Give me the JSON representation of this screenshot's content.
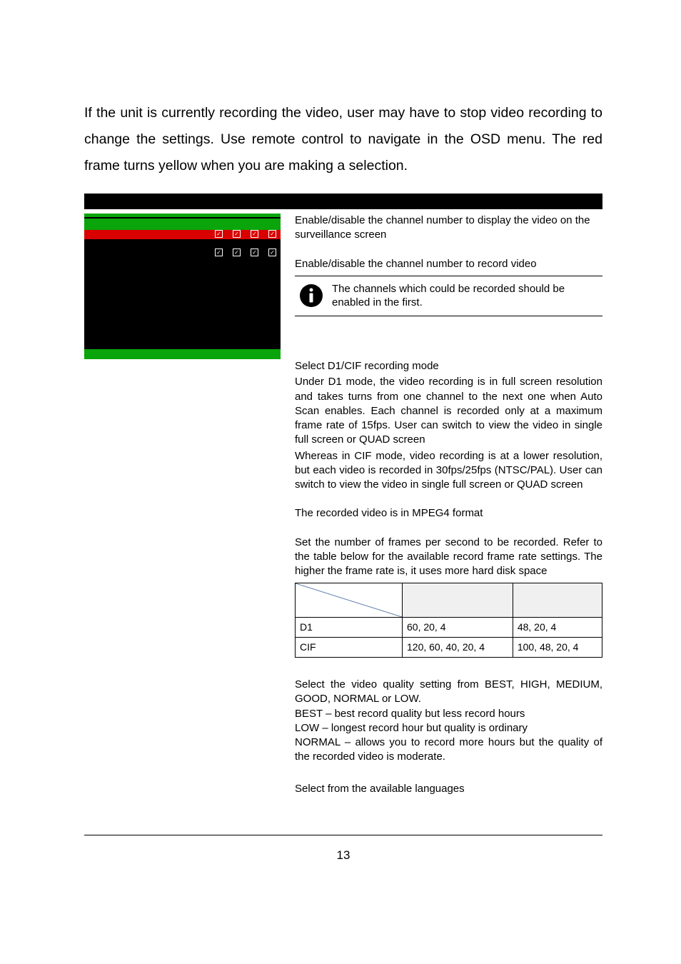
{
  "intro": "If the unit is currently recording the video, user may have to stop video recording to change the settings. Use remote control to navigate in the OSD menu. The red frame turns yellow when you are making a selection.",
  "camera_select": {
    "text": "Enable/disable the channel number to display the video on the surveillance screen"
  },
  "record_select": {
    "text": "Enable/disable the channel number to record video",
    "note": "The channels which could be recorded should be enabled in the",
    "note_tail": "first."
  },
  "record_mode": {
    "head": "Select D1/CIF recording mode",
    "p1": "Under D1 mode, the video recording is in full screen resolution and takes turns from one channel to the next one when Auto Scan enables. Each channel is recorded only at a maximum frame rate of 15fps. User can switch to view the video in single full screen or QUAD screen",
    "p2": "Whereas in CIF mode, video recording is at a lower resolution, but each video is recorded in 30fps/25fps (NTSC/PAL). User can switch to view the video in single full screen or QUAD screen"
  },
  "video_format": "The recorded video is in MPEG4 format",
  "frame_rate": {
    "p": "Set the number of frames per second to be recorded. Refer to the table below for the available record frame rate settings. The higher the frame rate is, it uses more hard disk space",
    "rows": [
      {
        "label": "D1",
        "ntsc": "60, 20, 4",
        "pal": "48, 20, 4"
      },
      {
        "label": "CIF",
        "ntsc": "120, 60, 40, 20, 4",
        "pal": "100, 48, 20, 4"
      }
    ]
  },
  "video_quality": {
    "p1": "Select the video quality setting from BEST, HIGH, MEDIUM, GOOD, NORMAL or LOW.",
    "p2": "BEST – best record quality but less record hours",
    "p3": "LOW – longest record hour but quality is ordinary",
    "p4": "NORMAL – allows you to record more hours but the quality of the recorded video is moderate."
  },
  "language": "Select from the available languages",
  "page_number": "13"
}
